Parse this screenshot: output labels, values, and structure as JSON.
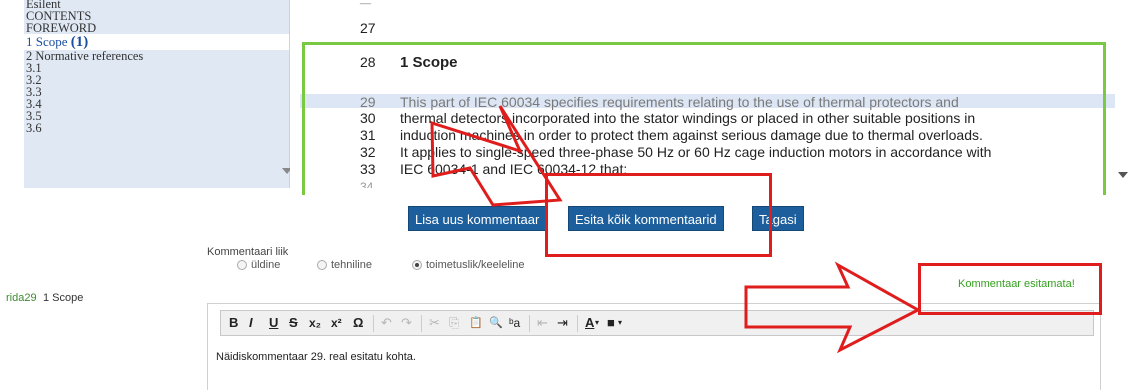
{
  "toc": {
    "items": [
      {
        "label": "Esilent",
        "count": ""
      },
      {
        "label": "CONTENTS",
        "count": ""
      },
      {
        "label": "FOREWORD",
        "count": ""
      },
      {
        "label": "1 Scope ",
        "count": "(1)"
      },
      {
        "label": "2 Normative references",
        "count": ""
      },
      {
        "label": "3.1",
        "count": ""
      },
      {
        "label": "3.2",
        "count": ""
      },
      {
        "label": "3.3",
        "count": ""
      },
      {
        "label": "3.4",
        "count": ""
      },
      {
        "label": "3.5",
        "count": ""
      },
      {
        "label": "3.6",
        "count": ""
      }
    ]
  },
  "document": {
    "lines": [
      {
        "num": "27",
        "text": ""
      },
      {
        "num": "28",
        "text": "1   Scope"
      },
      {
        "num": "29",
        "text": "This part of IEC 60034 specifies requirements relating to the use of thermal protectors and"
      },
      {
        "num": "30",
        "text": "thermal detectors incorporated into the stator windings or placed in other suitable positions in"
      },
      {
        "num": "31",
        "text": "induction machines in order to protect them against serious damage due to thermal overloads."
      },
      {
        "num": "32",
        "text": "It applies to single-speed three-phase 50 Hz or 60 Hz cage induction motors in accordance with"
      },
      {
        "num": "33",
        "text": "IEC 60034-1 and IEC 60034-12 that:"
      }
    ]
  },
  "buttons": {
    "add": "Lisa uus kommentaar",
    "submit_all": "Esita kõik kommentaarid",
    "back": "Tagasi"
  },
  "comment": {
    "kind_label": "Kommentaari liik",
    "options": [
      "üldine",
      "tehniline",
      "toimetuslik/keeleline"
    ],
    "selected": "toimetuslik/keeleline",
    "row_ref": "rida29",
    "row_title": "1 Scope",
    "status": "Kommentaar esitamata!",
    "editor_text": "Näidiskommentaar 29. real esitatu kohta."
  },
  "toolbar": {
    "bold": "B",
    "italic": "I",
    "underline": "U",
    "strike": "S",
    "subscript": "x₂",
    "superscript": "x²",
    "special_char": "Ω",
    "undo": "↶",
    "redo": "↷",
    "cut": "✂",
    "copy": "⎘",
    "paste": "📋",
    "find": "🔍",
    "replace": "ᵇa",
    "outdent": "⇤",
    "indent": "⇥",
    "text_color": "A",
    "bg_color": "■"
  },
  "colors": {
    "button_bg": "#1d5f9c",
    "toc_bg": "#dfe8f3",
    "scope_border": "#7ac943",
    "annotation_red": "#e01d1d",
    "status_green": "#35a11f"
  }
}
